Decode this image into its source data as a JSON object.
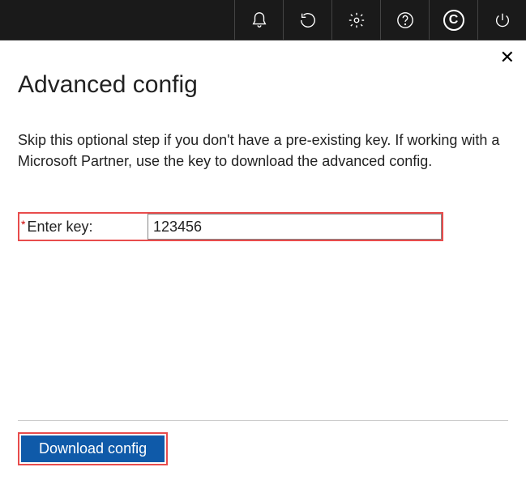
{
  "topbar": {
    "icons": [
      "bell-icon",
      "refresh-icon",
      "gear-icon",
      "help-icon",
      "copyright-icon",
      "power-icon"
    ],
    "copyright_glyph": "C"
  },
  "panel": {
    "close_glyph": "✕",
    "title": "Advanced config",
    "description": "Skip this optional step if you don't have a pre-existing key. If working with a Microsoft Partner, use the key to download the advanced config.",
    "field": {
      "required_mark": "*",
      "label": "Enter key:",
      "value": "123456"
    },
    "download_label": "Download config"
  }
}
